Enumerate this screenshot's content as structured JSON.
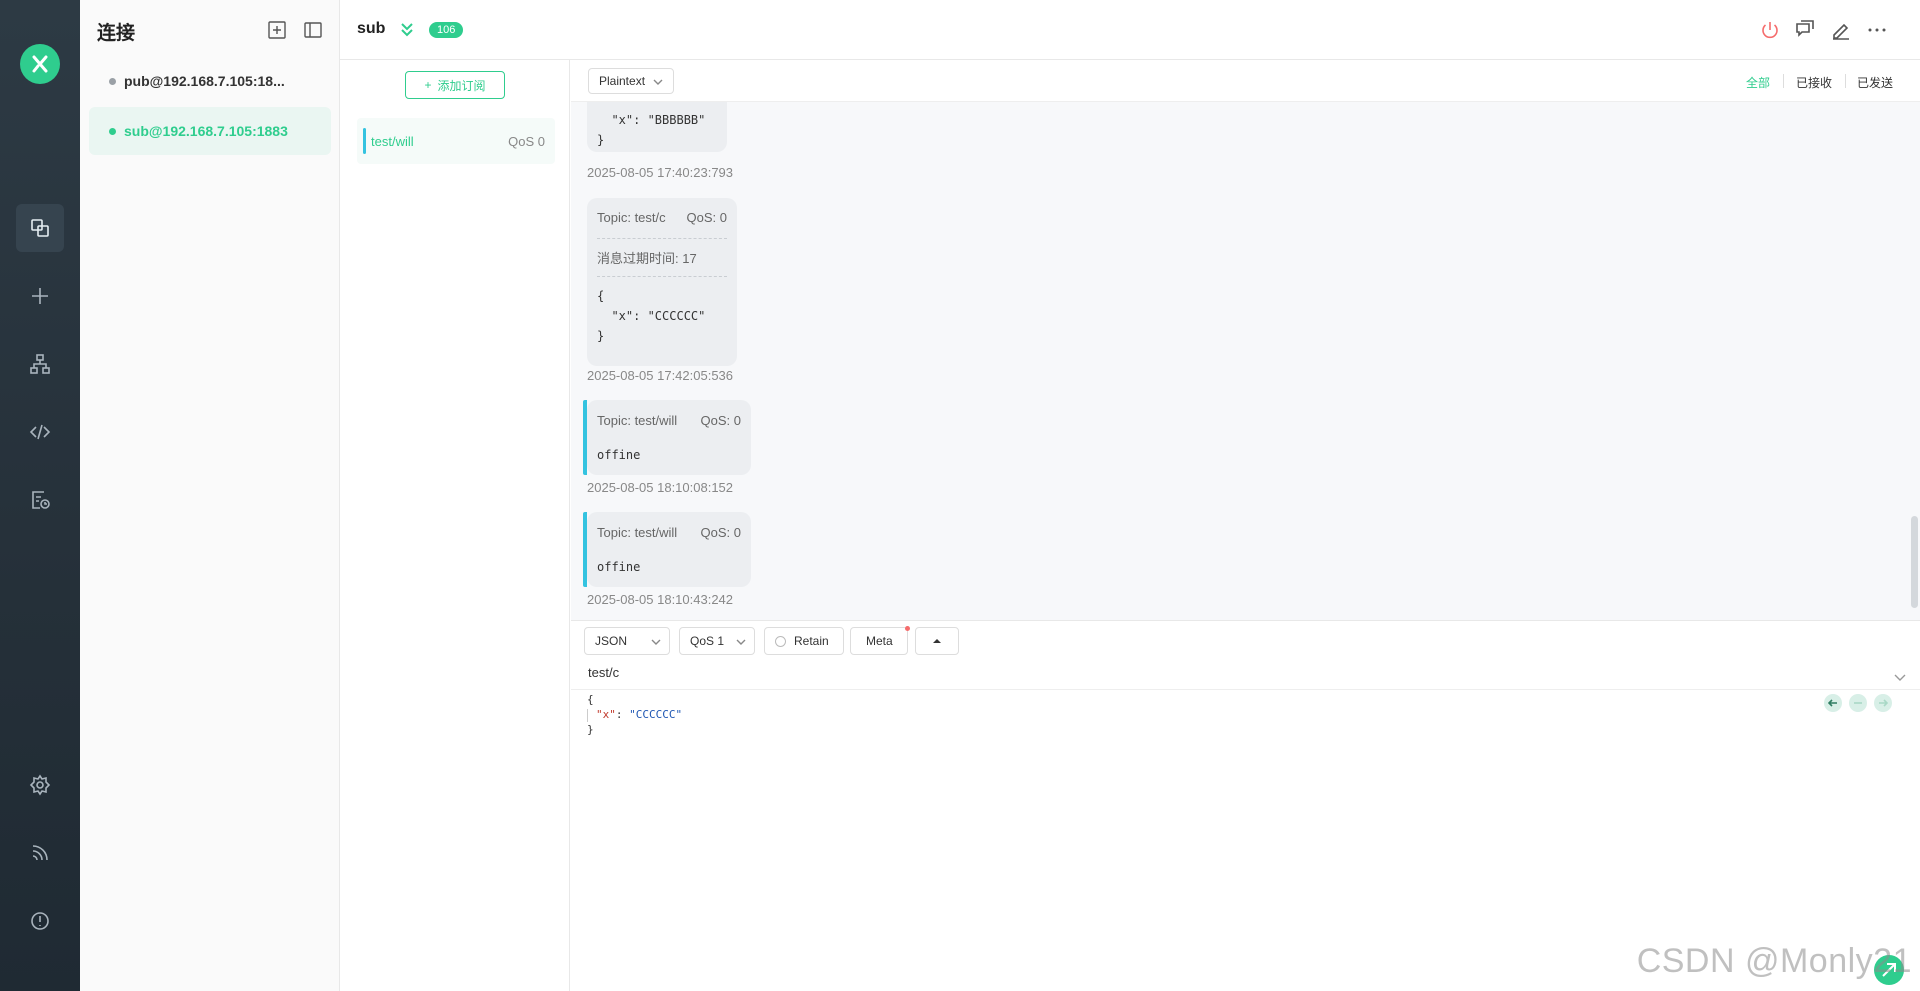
{
  "rail": {
    "items": [
      "logo-icon",
      "connections-icon",
      "new-connection-icon",
      "script-tree-icon",
      "code-icon",
      "log-icon",
      "settings-icon",
      "feed-icon",
      "about-icon"
    ]
  },
  "connections": {
    "title": "连接",
    "items": [
      {
        "label": "pub@192.168.7.105:18...",
        "status_color": "#9aa0a6"
      },
      {
        "label": "sub@192.168.7.105:1883",
        "status_color": "#2fcd8e"
      }
    ]
  },
  "header": {
    "name": "sub",
    "count_badge": "106"
  },
  "subscriptions": {
    "add_label": "添加订阅",
    "items": [
      {
        "topic": "test/will",
        "qos": "QoS 0",
        "color": "#34c3e0"
      }
    ]
  },
  "message_toolbar": {
    "payload_type": "Plaintext",
    "filters": [
      "全部",
      "已接收",
      "已发送"
    ]
  },
  "messages": [
    {
      "payload": "  \"x\": \"BBBBBB\"\n}",
      "timestamp": "2025-08-05 17:40:23:793"
    },
    {
      "topic": "Topic: test/c",
      "qos": "QoS: 0",
      "expiry": "消息过期时间: 17",
      "payload": "{\n  \"x\": \"CCCCCC\"\n}",
      "timestamp": "2025-08-05 17:42:05:536"
    },
    {
      "topic": "Topic: test/will",
      "qos": "QoS: 0",
      "payload": "offine",
      "timestamp": "2025-08-05 18:10:08:152"
    },
    {
      "topic": "Topic: test/will",
      "qos": "QoS: 0",
      "payload": "offine",
      "timestamp": "2025-08-05 18:10:43:242"
    }
  ],
  "publish": {
    "format": "JSON",
    "qos": "QoS 1",
    "retain_label": "Retain",
    "meta_label": "Meta",
    "topic": "test/c",
    "payload_open": "{",
    "payload_key": "\"x\"",
    "payload_colon": ": ",
    "payload_value": "\"CCCCCC\"",
    "payload_close": "}"
  },
  "watermark": "CSDN @Monly21"
}
